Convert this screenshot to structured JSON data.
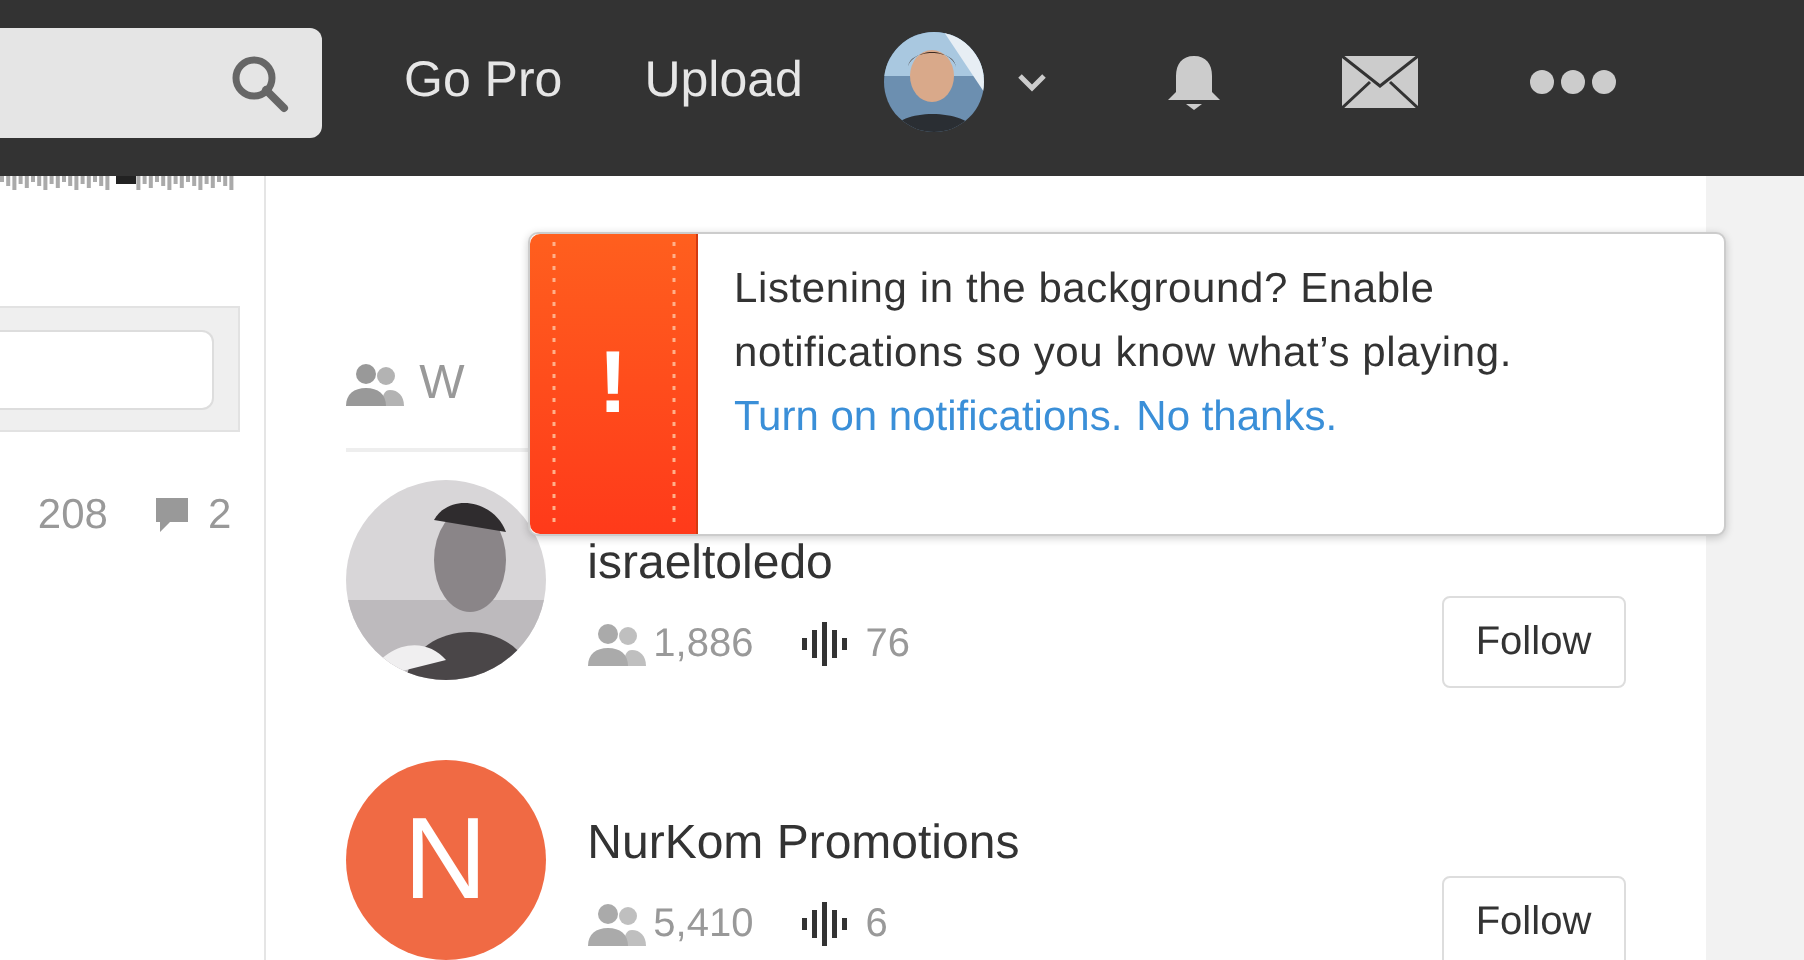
{
  "header": {
    "nav": [
      "Go Pro",
      "Upload"
    ]
  },
  "left": {
    "stats": [
      {
        "kind": "plays",
        "text": "208"
      },
      {
        "kind": "comments",
        "text": "2"
      }
    ]
  },
  "module": {
    "title": "W"
  },
  "users": [
    {
      "name": "israeltoledo",
      "followers": "1,886",
      "tracks": "76",
      "button": "Follow",
      "kind": "picture"
    },
    {
      "name": "NurKom Promotions",
      "followers": "5,410",
      "tracks": "6",
      "button": "Follow",
      "kind": "logo",
      "logo_letter": "N"
    }
  ],
  "popup": {
    "mark": "!",
    "message": "Listening in the background? Enable notifications so you know what’s playing.",
    "links": [
      "Turn on notifications.",
      "No thanks."
    ]
  }
}
